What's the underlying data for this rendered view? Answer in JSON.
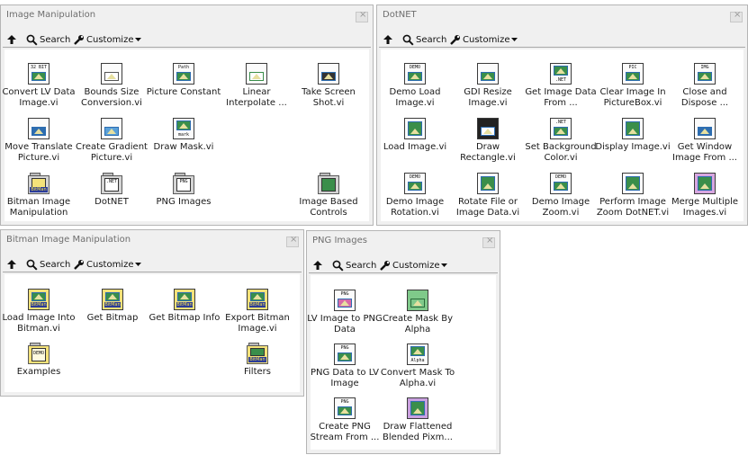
{
  "toolbar": {
    "search": "Search",
    "customize": "Customize"
  },
  "palettes": {
    "image_manipulation": {
      "title": "Image Manipulation",
      "items": [
        {
          "icon": "vi-convert-icon",
          "header": "32 BIT",
          "label": "Convert LV Data Image.vi"
        },
        {
          "icon": "vi-bounds-icon",
          "header": "",
          "label": "Bounds Size Conversion.vi"
        },
        {
          "icon": "vi-picture-constant-icon",
          "header": "Path",
          "label": "Picture Constant"
        },
        {
          "icon": "vi-linear-interpolate-icon",
          "header": "",
          "label": "Linear Interpolate ..."
        },
        {
          "icon": "vi-screenshot-icon",
          "header": "",
          "label": "Take Screen Shot.vi"
        },
        {
          "icon": "vi-move-translate-icon",
          "header": "",
          "label": "Move Translate Picture.vi"
        },
        {
          "icon": "vi-gradient-icon",
          "header": "",
          "label": "Create Gradient Picture.vi"
        },
        {
          "icon": "vi-draw-mask-icon",
          "header": "mark",
          "label": "Draw Mask.vi"
        },
        {
          "icon": "folder-bitman-icon",
          "header": "BitMan",
          "label": "Bitman Image Manipulation"
        },
        {
          "icon": "folder-dotnet-icon",
          "header": ".NET",
          "label": "DotNET"
        },
        {
          "icon": "folder-png-icon",
          "header": "PNG",
          "label": "PNG Images"
        },
        {
          "icon": "folder-image-controls-icon",
          "header": "",
          "label": "Image Based Controls"
        }
      ]
    },
    "dotnet": {
      "title": "DotNET",
      "items": [
        {
          "icon": "vi-demo-load-icon",
          "header": "DEMO",
          "label": "Demo Load Image.vi"
        },
        {
          "icon": "vi-gdi-resize-icon",
          "header": "",
          "label": "GDI Resize Image.vi"
        },
        {
          "icon": "vi-get-image-data-icon",
          "header": ".NET",
          "label": "Get Image Data From ..."
        },
        {
          "icon": "vi-clear-image-icon",
          "header": "PIC",
          "label": "Clear Image In PictureBox.vi"
        },
        {
          "icon": "vi-close-dispose-icon",
          "header": "IMG",
          "label": "Close and Dispose ..."
        },
        {
          "icon": "vi-load-image-icon",
          "header": "",
          "label": "Load Image.vi"
        },
        {
          "icon": "vi-draw-rectangle-icon",
          "header": "",
          "label": "Draw Rectangle.vi"
        },
        {
          "icon": "vi-set-bg-color-icon",
          "header": ".NET",
          "label": "Set Background Color.vi"
        },
        {
          "icon": "vi-display-image-icon",
          "header": "",
          "label": "Display Image.vi"
        },
        {
          "icon": "vi-get-window-image-icon",
          "header": "",
          "label": "Get Window Image From ..."
        },
        {
          "icon": "vi-demo-rotation-icon",
          "header": "DEMO",
          "label": "Demo Image Rotation.vi"
        },
        {
          "icon": "vi-rotate-file-icon",
          "header": "",
          "label": "Rotate File or Image Data.vi"
        },
        {
          "icon": "vi-demo-zoom-icon",
          "header": "DEMO",
          "label": "Demo Image Zoom.vi"
        },
        {
          "icon": "vi-perform-zoom-icon",
          "header": "",
          "label": "Perform Image Zoom DotNET.vi"
        },
        {
          "icon": "vi-merge-images-icon",
          "header": "",
          "label": "Merge Multiple Images.vi"
        }
      ]
    },
    "bitman": {
      "title": "Bitman Image Manipulation",
      "items": [
        {
          "icon": "vi-bitman-load-icon",
          "header": "BitMan",
          "label": "Load Image Into Bitman.vi"
        },
        {
          "icon": "vi-bitman-get-bitmap-icon",
          "header": "BitMan",
          "label": "Get Bitmap"
        },
        {
          "icon": "vi-bitman-get-info-icon",
          "header": "BitMan",
          "label": "Get Bitmap Info"
        },
        {
          "icon": "vi-bitman-export-icon",
          "header": "BitMan",
          "label": "Export Bitman Image.vi"
        },
        {
          "icon": "folder-examples-icon",
          "header": "DEMO",
          "label": "Examples"
        },
        {
          "icon": "folder-filters-icon",
          "header": "BitMan",
          "label": "Filters"
        }
      ]
    },
    "png": {
      "title": "PNG Images",
      "items": [
        {
          "icon": "vi-lv-to-png-icon",
          "header": "PNG",
          "label": "LV Image to PNG Data"
        },
        {
          "icon": "vi-mask-alpha-icon",
          "header": "",
          "label": "Create Mask By Alpha"
        },
        {
          "icon": "vi-png-to-lv-icon",
          "header": "PNG",
          "label": "PNG Data to LV Image"
        },
        {
          "icon": "vi-convert-mask-icon",
          "header": "Alpha",
          "label": "Convert Mask To Alpha.vi"
        },
        {
          "icon": "vi-create-png-stream-icon",
          "header": "PNG",
          "label": "Create PNG Stream From ..."
        },
        {
          "icon": "vi-draw-flattened-icon",
          "header": "",
          "label": "Draw Flattened Blended Pixm..."
        }
      ]
    }
  }
}
